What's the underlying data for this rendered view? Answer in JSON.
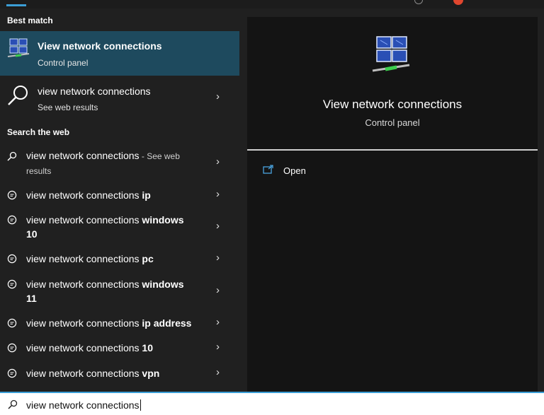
{
  "left_panel": {
    "best_match_heading": "Best match",
    "best_match": {
      "title": "View network connections",
      "subtitle": "Control panel"
    },
    "web_result": {
      "title": "view network connections",
      "subtitle": "See web results"
    },
    "search_web_heading": "Search the web",
    "suggestions": [
      {
        "prefix": "view network connections",
        "bold": "",
        "suffix": " - See web results",
        "icon": "search-icon"
      },
      {
        "prefix": "view network connections ",
        "bold": "ip",
        "suffix": "",
        "icon": "chat-icon"
      },
      {
        "prefix": "view network connections ",
        "bold": "windows 10",
        "suffix": "",
        "icon": "chat-icon"
      },
      {
        "prefix": "view network connections ",
        "bold": "pc",
        "suffix": "",
        "icon": "chat-icon"
      },
      {
        "prefix": "view network connections ",
        "bold": "windows 11",
        "suffix": "",
        "icon": "chat-icon"
      },
      {
        "prefix": "view network connections ",
        "bold": "ip address",
        "suffix": "",
        "icon": "chat-icon"
      },
      {
        "prefix": "view network connections ",
        "bold": "10",
        "suffix": "",
        "icon": "chat-icon"
      },
      {
        "prefix": "view network connections ",
        "bold": "vpn",
        "suffix": "",
        "icon": "chat-icon"
      }
    ]
  },
  "right_panel": {
    "title": "View network connections",
    "subtitle": "Control panel",
    "actions": [
      {
        "label": "Open",
        "icon": "open-external-icon"
      }
    ]
  },
  "search_box": {
    "value": "view network connections",
    "icon": "search-icon"
  },
  "colors": {
    "accent": "#3b9ed6",
    "selected_row": "#1e4a5e",
    "background": "#202020",
    "preview_panel": "#141414"
  }
}
